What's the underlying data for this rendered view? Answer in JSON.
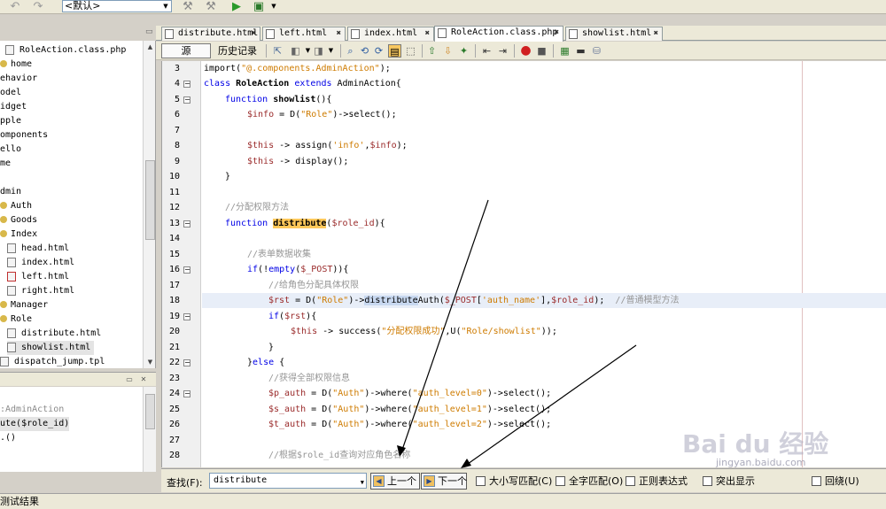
{
  "toolbar": {
    "encoding_select": "<默认>"
  },
  "tree": {
    "items": [
      {
        "label": "RoleAction.class.php",
        "kind": "file"
      },
      {
        "label": "home",
        "kind": "folder"
      },
      {
        "label": "ehavior",
        "kind": "plain"
      },
      {
        "label": "odel",
        "kind": "plain"
      },
      {
        "label": "idget",
        "kind": "plain"
      },
      {
        "label": "pple",
        "kind": "plain"
      },
      {
        "label": "omponents",
        "kind": "plain"
      },
      {
        "label": "ello",
        "kind": "plain"
      },
      {
        "label": "me",
        "kind": "plain"
      },
      {
        "label": "",
        "kind": "plain"
      },
      {
        "label": "dmin",
        "kind": "plain"
      },
      {
        "label": "Auth",
        "kind": "folder"
      },
      {
        "label": "Goods",
        "kind": "folder"
      },
      {
        "label": "Index",
        "kind": "folder"
      },
      {
        "label": "head.html",
        "kind": "file"
      },
      {
        "label": "index.html",
        "kind": "file"
      },
      {
        "label": "left.html",
        "kind": "file"
      },
      {
        "label": "right.html",
        "kind": "file"
      },
      {
        "label": "Manager",
        "kind": "folder"
      },
      {
        "label": "Role",
        "kind": "folder"
      },
      {
        "label": "distribute.html",
        "kind": "file"
      },
      {
        "label": "showlist.html",
        "kind": "file"
      },
      {
        "label": "dispatch_jump.tpl",
        "kind": "file"
      }
    ]
  },
  "navigator": {
    "items": [
      ":AdminAction",
      "ute($role_id)",
      ".()"
    ]
  },
  "tabs": [
    {
      "label": "distribute.html"
    },
    {
      "label": "left.html"
    },
    {
      "label": "index.html"
    },
    {
      "label": "RoleAction.class.php"
    },
    {
      "label": "showlist.html"
    }
  ],
  "editor_toolbar": {
    "source_label": "源",
    "history_label": "历史记录"
  },
  "editor": {
    "line_numbers": [
      "3",
      "4",
      "5",
      "6",
      "7",
      "8",
      "9",
      "10",
      "11",
      "12",
      "13",
      "14",
      "15",
      "16",
      "17",
      "18",
      "19",
      "20",
      "21",
      "22",
      "23",
      "24",
      "25",
      "26",
      "27",
      "28"
    ],
    "lines": {
      "l3_a": "import(",
      "l3_b": "\"@.components.AdminAction\"",
      "l3_c": ");",
      "l4_a": "class ",
      "l4_b": "RoleAction",
      "l4_c": " extends ",
      "l4_d": "AdminAction{",
      "l5_a": "function ",
      "l5_b": "showlist",
      "l5_c": "(){",
      "l6_a": "$info",
      "l6_b": " = D(",
      "l6_c": "\"Role\"",
      "l6_d": ")->select();",
      "l8_a": "$this",
      "l8_b": " -> assign(",
      "l8_c": "'info'",
      "l8_d": ",",
      "l8_e": "$info",
      "l8_f": ");",
      "l9_a": "$this",
      "l9_b": " -> display();",
      "l10": "}",
      "l12": "//分配权限方法",
      "l13_a": "function ",
      "l13_b": "distribute",
      "l13_c": "(",
      "l13_d": "$role_id",
      "l13_e": "){",
      "l15": "//表单数据收集",
      "l16_a": "if",
      "l16_b": "(!",
      "l16_c": "empty",
      "l16_d": "(",
      "l16_e": "$_POST",
      "l16_f": ")){",
      "l17": "//给角色分配具体权限",
      "l18_a": "$rst",
      "l18_b": " = D(",
      "l18_c": "\"Role\"",
      "l18_d": ")->",
      "l18_e": "distribute",
      "l18_f": "Auth(",
      "l18_g": "$_POST",
      "l18_h": "[",
      "l18_i": "'auth_name'",
      "l18_j": "],",
      "l18_k": "$role_id",
      "l18_l": ");  ",
      "l18_m": "//普通模型方法",
      "l19_a": "if",
      "l19_b": "(",
      "l19_c": "$rst",
      "l19_d": "){",
      "l20_a": "$this",
      "l20_b": " -> success(",
      "l20_c": "\"分配权限成功\"",
      "l20_d": ",U(",
      "l20_e": "\"Role/showlist\"",
      "l20_f": "));",
      "l21": "}",
      "l22_a": "}",
      "l22_b": "else",
      "l22_c": " {",
      "l23": "//获得全部权限信息",
      "l24_a": "$p_auth",
      "l24_b": " = D(",
      "l24_c": "\"Auth\"",
      "l24_d": ")->where(",
      "l24_e": "\"auth_level=0\"",
      "l24_f": ")->select();",
      "l25_a": "$s_auth",
      "l25_b": " = D(",
      "l25_c": "\"Auth\"",
      "l25_d": ")->where(",
      "l25_e": "\"auth_level=1\"",
      "l25_f": ")->select();",
      "l26_a": "$t_auth",
      "l26_b": " = D(",
      "l26_c": "\"Auth\"",
      "l26_d": ")->where(",
      "l26_e": "\"auth_level=2\"",
      "l26_f": ")->select();",
      "l28": "//根据$role_id查询对应角色名称"
    }
  },
  "findbar": {
    "label": "查找(F):",
    "query": "distribute",
    "prev_label": "上一个",
    "next_label": "下一个",
    "match_case": "大小写匹配(C)",
    "whole_word": "全字匹配(O)",
    "regex": "正则表达式",
    "highlight": "突出显示",
    "wrap": "回绕(U)"
  },
  "statusbar": {
    "label": "测试结果"
  },
  "watermark": {
    "brand": "Bai du 经验",
    "sub": "jingyan.baidu.com"
  },
  "colors": {
    "keyword": "#0000e6",
    "variable": "#9a2a2a",
    "string": "#ce7b00",
    "comment": "#969696",
    "match_highlight": "#ffc85a"
  }
}
